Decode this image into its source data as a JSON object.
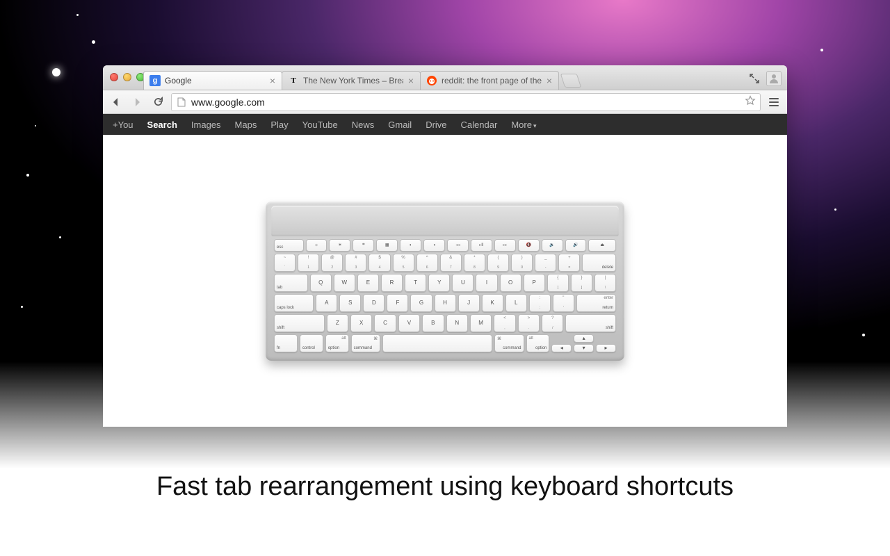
{
  "promo": {
    "caption": "Fast tab rearrangement using keyboard shortcuts"
  },
  "tabs": [
    {
      "title": "Google",
      "favicon": "google"
    },
    {
      "title": "The New York Times – Break",
      "favicon": "nyt"
    },
    {
      "title": "reddit: the front page of the",
      "favicon": "reddit"
    }
  ],
  "omnibox": {
    "url": "www.google.com"
  },
  "googlebar": {
    "items": [
      "+You",
      "Search",
      "Images",
      "Maps",
      "Play",
      "YouTube",
      "News",
      "Gmail",
      "Drive",
      "Calendar"
    ],
    "more": "More",
    "activeIndex": 1
  },
  "keyboard": {
    "fn_row": [
      "esc",
      "☼",
      "☀",
      "⌗",
      "▦",
      "◐",
      "◑",
      "◃◃",
      "▹II",
      "▹▹",
      "🔇",
      "🔉",
      "🔊",
      "⏏"
    ],
    "num_row_top": [
      "~",
      "!",
      "@",
      "#",
      "$",
      "%",
      "^",
      "&",
      "*",
      "(",
      ")",
      "_",
      "+"
    ],
    "num_row": [
      "`",
      "1",
      "2",
      "3",
      "4",
      "5",
      "6",
      "7",
      "8",
      "9",
      "0",
      "-",
      "="
    ],
    "num_row_del": "delete",
    "q_row_tab": "tab",
    "q_row": [
      "Q",
      "W",
      "E",
      "R",
      "T",
      "Y",
      "U",
      "I",
      "O",
      "P",
      "[",
      "]",
      "\\"
    ],
    "q_row_top": [
      "",
      "",
      "",
      "",
      "",
      "",
      "",
      "",
      "",
      "",
      "{",
      "}",
      "|"
    ],
    "a_row_caps": "caps lock",
    "a_row": [
      "A",
      "S",
      "D",
      "F",
      "G",
      "H",
      "J",
      "K",
      "L",
      ";",
      "'"
    ],
    "a_row_top": [
      "",
      "",
      "",
      "",
      "",
      "",
      "",
      "",
      "",
      ":",
      "\""
    ],
    "a_row_ret": "return",
    "a_row_ret2": "enter",
    "z_row_shift": "shift",
    "z_row": [
      "Z",
      "X",
      "C",
      "V",
      "B",
      "N",
      "M",
      ",",
      ".",
      "/"
    ],
    "z_row_top": [
      "",
      "",
      "",
      "",
      "",
      "",
      "",
      "<",
      ">",
      "?"
    ],
    "bottom": {
      "fn": "fn",
      "ctrl": "control",
      "alt": "alt",
      "opt": "option",
      "cmd": "command",
      "cmd_sym": "⌘"
    },
    "arrows": {
      "up": "▴",
      "down": "▾",
      "left": "◂",
      "right": "▸"
    }
  }
}
